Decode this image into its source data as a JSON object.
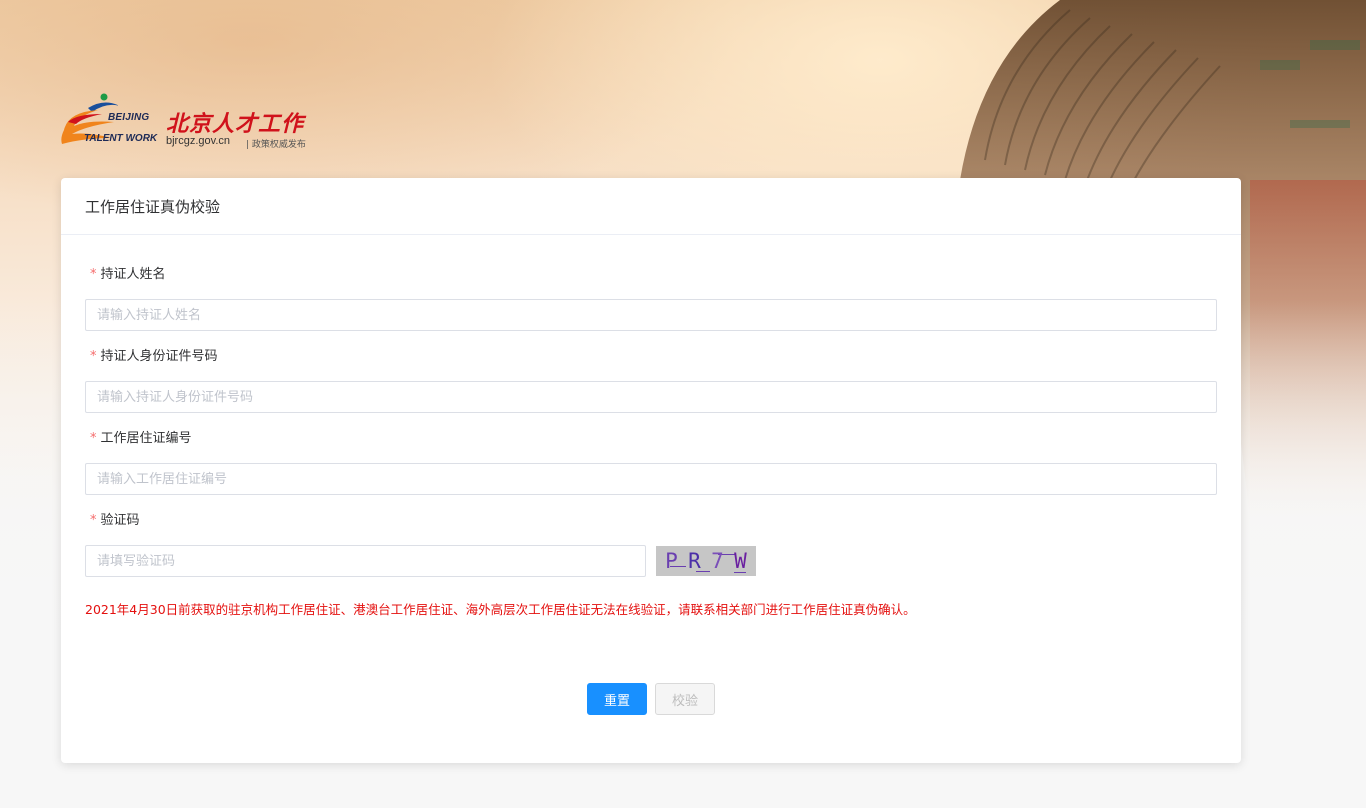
{
  "logo": {
    "en_line1": "BEIJING",
    "en_line2": "TALENT WORK",
    "cn_name": "北京人才工作",
    "url": "bjrcgz.gov.cn",
    "slogan": "| 政策权威发布",
    "colors": {
      "red": "#d0121b",
      "orange": "#f0841c",
      "blue": "#1a4f9c",
      "green": "#1e9b46"
    }
  },
  "card": {
    "title": "工作居住证真伪校验"
  },
  "form": {
    "name": {
      "label": "持证人姓名",
      "placeholder": "请输入持证人姓名",
      "required_mark": "*"
    },
    "id_number": {
      "label": "持证人身份证件号码",
      "placeholder": "请输入持证人身份证件号码",
      "required_mark": "*"
    },
    "permit_number": {
      "label": "工作居住证编号",
      "placeholder": "请输入工作居住证编号",
      "required_mark": "*"
    },
    "captcha": {
      "label": "验证码",
      "placeholder": "请填写验证码",
      "required_mark": "*",
      "chars": [
        "P",
        "R",
        "7",
        "W"
      ],
      "char_colors": [
        "#6a3fb0",
        "#4b2fa8",
        "#7a4fb8",
        "#6a1fa0"
      ]
    }
  },
  "notice": "2021年4月30日前获取的驻京机构工作居住证、港澳台工作居住证、海外高层次工作居住证无法在线验证，请联系相关部门进行工作居住证真伪确认。",
  "buttons": {
    "reset": "重置",
    "verify": "校验"
  },
  "theme": {
    "primary": "#1890ff",
    "notice_color": "#e4100f",
    "required_color": "#f56c6c"
  }
}
